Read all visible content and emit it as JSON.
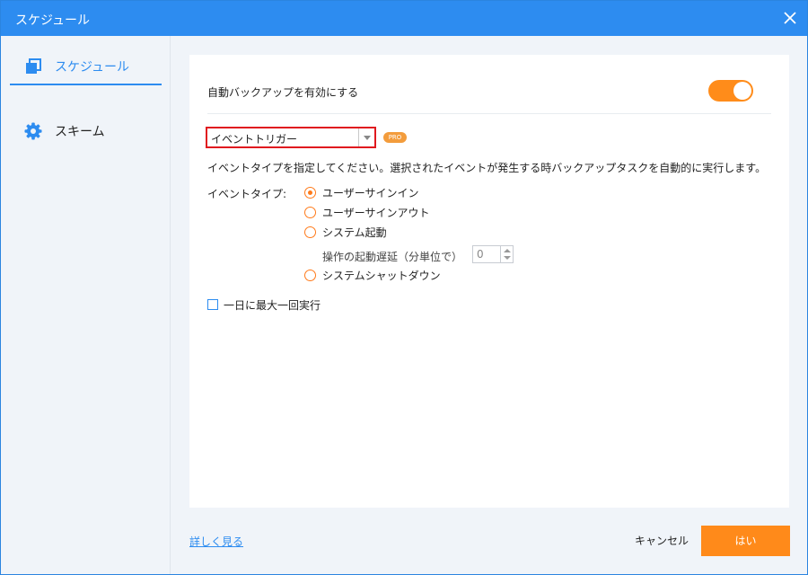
{
  "window": {
    "title": "スケジュール"
  },
  "sidebar": {
    "items": [
      {
        "label": "スケジュール",
        "icon": "copy-icon",
        "active": true
      },
      {
        "label": "スキーム",
        "icon": "gear-icon",
        "active": false
      }
    ]
  },
  "settings": {
    "auto_backup_label": "自動バックアップを有効にする",
    "auto_backup_enabled": true,
    "trigger_select_value": "イベントトリガー",
    "pro_badge": "PRO",
    "description": "イベントタイプを指定してください。選択されたイベントが発生する時バックアップタスクを自動的に実行します。",
    "event_type_label": "イベントタイプ:",
    "event_types": [
      {
        "label": "ユーザーサインイン",
        "checked": true
      },
      {
        "label": "ユーザーサインアウト",
        "checked": false
      },
      {
        "label": "システム起動",
        "checked": false
      },
      {
        "label": "システムシャットダウン",
        "checked": false
      }
    ],
    "startup_delay_label": "操作の起動遅延（分単位で）",
    "startup_delay_value": "0",
    "once_a_day_label": "一日に最大一回実行",
    "once_a_day_checked": false
  },
  "footer": {
    "more_link": "詳しく見る",
    "cancel_label": "キャンセル",
    "ok_label": "はい"
  },
  "colors": {
    "accent_blue": "#2d8cf0",
    "accent_orange": "#ff8a1a",
    "highlight_red": "#e0191f"
  }
}
